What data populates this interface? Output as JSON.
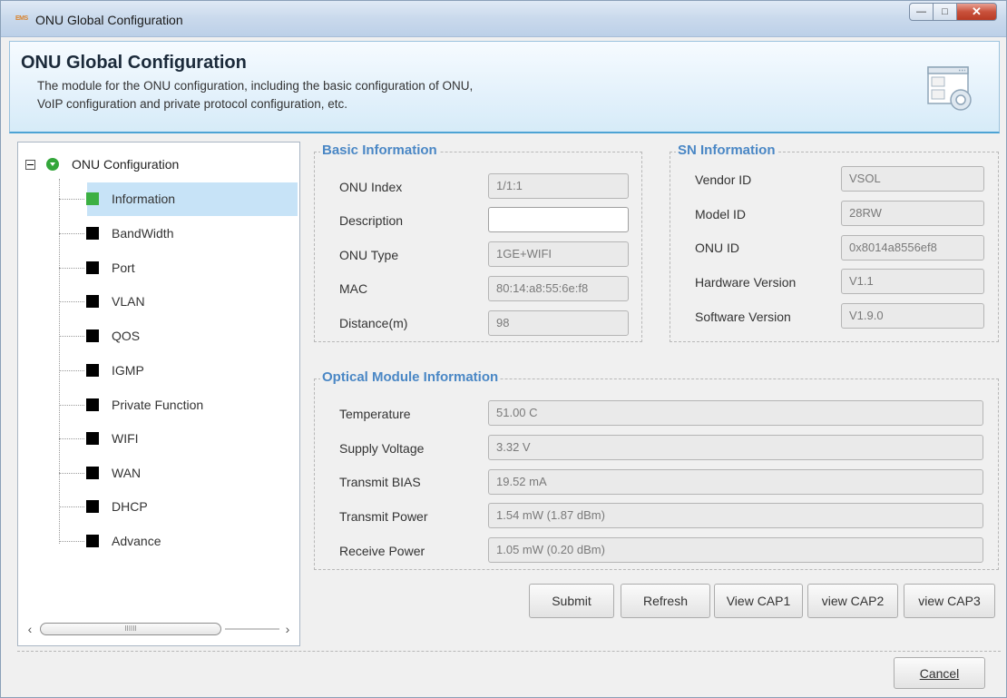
{
  "window": {
    "title": "ONU Global Configuration",
    "app_icon_text": "EMS"
  },
  "banner": {
    "title": "ONU Global Configuration",
    "desc_line1": "The module for the ONU configuration, including the basic configuration of ONU,",
    "desc_line2": "VoIP configuration and private protocol configuration, etc."
  },
  "tree": {
    "root_label": "ONU Configuration",
    "items": [
      {
        "label": "Information",
        "selected": true
      },
      {
        "label": "BandWidth"
      },
      {
        "label": "Port"
      },
      {
        "label": "VLAN"
      },
      {
        "label": "QOS"
      },
      {
        "label": "IGMP"
      },
      {
        "label": "Private Function"
      },
      {
        "label": "WIFI"
      },
      {
        "label": "WAN"
      },
      {
        "label": "DHCP"
      },
      {
        "label": "Advance"
      }
    ],
    "scroll_grip": "IIIIII"
  },
  "basic": {
    "title": "Basic Information",
    "fields": [
      {
        "label": "ONU Index",
        "value": "1/1:1"
      },
      {
        "label": "Description",
        "value": ""
      },
      {
        "label": "ONU Type",
        "value": "1GE+WIFI"
      },
      {
        "label": "MAC",
        "value": "80:14:a8:55:6e:f8"
      },
      {
        "label": "Distance(m)",
        "value": "98"
      }
    ]
  },
  "sn": {
    "title": "SN Information",
    "fields": [
      {
        "label": "Vendor ID",
        "value": "VSOL"
      },
      {
        "label": "Model ID",
        "value": "28RW"
      },
      {
        "label": "ONU ID",
        "value": "0x8014a8556ef8"
      },
      {
        "label": "Hardware Version",
        "value": "V1.1"
      },
      {
        "label": "Software Version",
        "value": "V1.9.0"
      }
    ]
  },
  "optical": {
    "title": "Optical Module Information",
    "fields": [
      {
        "label": "Temperature",
        "value": "51.00 C"
      },
      {
        "label": "Supply Voltage",
        "value": "3.32 V"
      },
      {
        "label": "Transmit BIAS",
        "value": "19.52 mA"
      },
      {
        "label": "Transmit Power",
        "value": "1.54 mW (1.87 dBm)"
      },
      {
        "label": "Receive Power",
        "value": "1.05 mW (0.20 dBm)"
      }
    ]
  },
  "actions": {
    "submit": "Submit",
    "refresh": "Refresh",
    "view_cap1": "View CAP1",
    "view_cap2": "view CAP2",
    "view_cap3": "view CAP3"
  },
  "footer": {
    "cancel": "Cancel"
  },
  "colors": {
    "group_title": "#4a87c5",
    "selected_bg": "#c7e3f7",
    "selected_marker": "#3cb043",
    "banner_border": "#4da3d4"
  }
}
